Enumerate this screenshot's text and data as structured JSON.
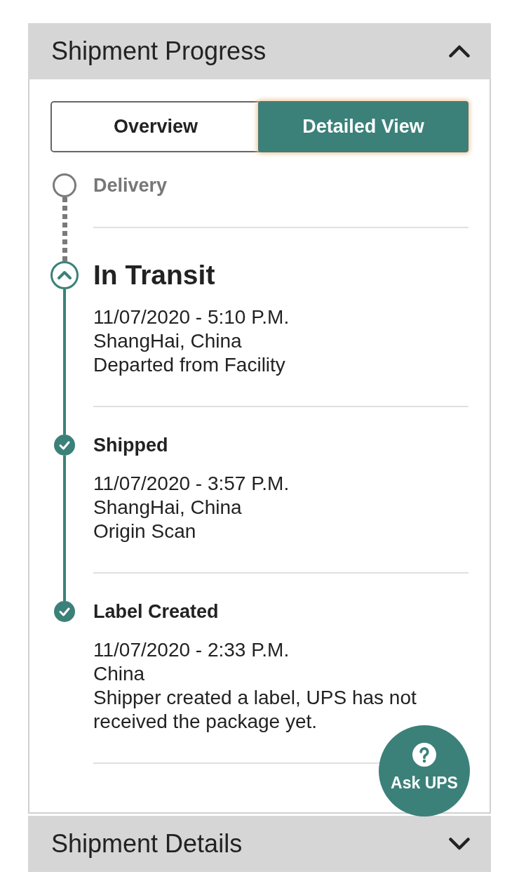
{
  "progress_panel": {
    "title": "Shipment Progress",
    "expanded": true,
    "view_toggle": [
      {
        "label": "Overview",
        "selected": false
      },
      {
        "label": "Detailed View",
        "selected": true
      }
    ],
    "milestones": [
      {
        "kind": "pending",
        "title": "Delivery"
      },
      {
        "kind": "current",
        "title": "In Transit",
        "date_time": "11/07/2020 - 5:10 P.M.",
        "location": "ShangHai, China",
        "activity": "Departed from Facility"
      },
      {
        "kind": "done",
        "title": "Shipped",
        "date_time": "11/07/2020 - 3:57 P.M.",
        "location": "ShangHai, China",
        "activity": "Origin Scan"
      },
      {
        "kind": "done",
        "title": "Label Created",
        "date_time": "11/07/2020 - 2:33 P.M.",
        "location": "China",
        "activity": "Shipper created a label, UPS has not received the package yet."
      }
    ]
  },
  "help_button": {
    "label": "Ask UPS"
  },
  "details_panel": {
    "title": "Shipment Details",
    "expanded": false
  }
}
